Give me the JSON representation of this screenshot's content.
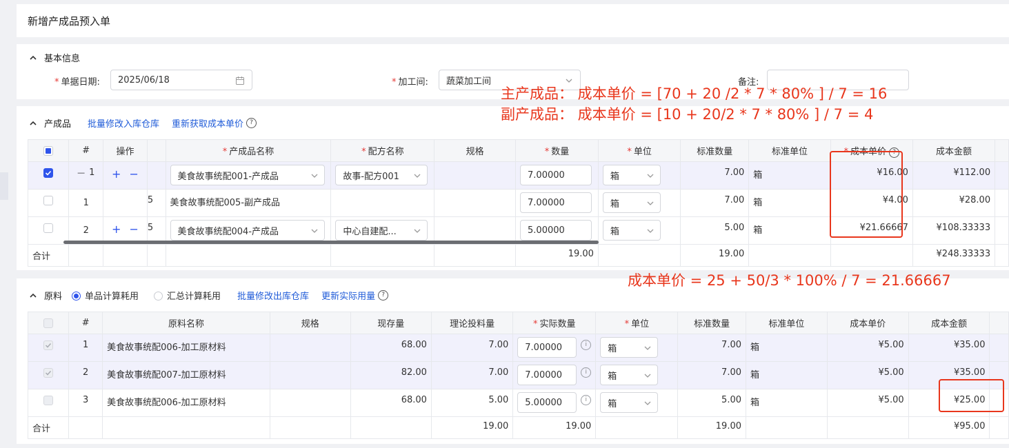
{
  "page": {
    "title": "新增产成品预入单"
  },
  "basic": {
    "section_title": "基本信息",
    "date_label": "单据日期:",
    "date_value": "2025/06/18",
    "workshop_label": "加工间:",
    "workshop_value": "蔬菜加工间",
    "remark_label": "备注:"
  },
  "products": {
    "section_title": "产成品",
    "link_batch": "批量修改入库仓库",
    "link_refetch": "重新获取成本单价",
    "headers": {
      "index": "#",
      "op": "操作",
      "name": "产成品名称",
      "recipe": "配方名称",
      "spec": "规格",
      "qty": "数量",
      "unit": "单位",
      "std_qty": "标准数量",
      "std_unit": "标准单位",
      "cost_price": "成本单价",
      "cost_amount": "成本金额"
    },
    "rows": [
      {
        "index": "1",
        "frag": "",
        "name": "美食故事统配001-产成品",
        "recipe": "故事-配方001",
        "qty": "7.00000",
        "unit": "箱",
        "std_qty": "7.00",
        "std_unit": "箱",
        "cost_price": "¥16.00",
        "cost_amount": "¥112.00"
      },
      {
        "index": "1",
        "frag": "5",
        "name": "美食故事统配005-副产成品",
        "recipe": "",
        "qty": "7.00000",
        "unit": "箱",
        "std_qty": "7.00",
        "std_unit": "箱",
        "cost_price": "¥4.00",
        "cost_amount": "¥28.00"
      },
      {
        "index": "2",
        "frag": "5",
        "name": "美食故事统配004-产成品",
        "recipe": "中心自建配...",
        "qty": "5.00000",
        "unit": "箱",
        "std_qty": "5.00",
        "std_unit": "箱",
        "cost_price": "¥21.66667",
        "cost_amount": "¥108.33333"
      }
    ],
    "summary": {
      "label": "合计",
      "qty": "19.00",
      "std_qty": "19.00",
      "cost_amount": "¥248.33333"
    },
    "op_plus": "+",
    "op_minus": "−"
  },
  "materials": {
    "section_title": "原料",
    "radio_single": "单品计算耗用",
    "radio_total": "汇总计算耗用",
    "link_batch": "批量修改出库仓库",
    "link_update": "更新实际用量",
    "headers": {
      "index": "#",
      "name": "原料名称",
      "spec": "规格",
      "stock": "现存量",
      "theory": "理论投料量",
      "actual": "实际数量",
      "unit": "单位",
      "std_qty": "标准数量",
      "std_unit": "标准单位",
      "cost_price": "成本单价",
      "cost_amount": "成本金额"
    },
    "rows": [
      {
        "index": "1",
        "name": "美食故事统配006-加工原材料",
        "stock": "68.00",
        "theory": "7.00",
        "actual": "7.00000",
        "unit": "箱",
        "std_qty": "7.00",
        "std_unit": "箱",
        "cost_price": "¥5.00",
        "cost_amount": "¥35.00"
      },
      {
        "index": "2",
        "name": "美食故事统配007-加工原材料",
        "stock": "82.00",
        "theory": "7.00",
        "actual": "7.00000",
        "unit": "箱",
        "std_qty": "7.00",
        "std_unit": "箱",
        "cost_price": "¥5.00",
        "cost_amount": "¥35.00"
      },
      {
        "index": "3",
        "name": "美食故事统配006-加工原材料",
        "stock": "68.00",
        "theory": "5.00",
        "actual": "5.00000",
        "unit": "箱",
        "std_qty": "5.00",
        "std_unit": "箱",
        "cost_price": "¥5.00",
        "cost_amount": "¥25.00"
      }
    ],
    "summary": {
      "label": "合计",
      "theory": "19.00",
      "actual": "19.00",
      "std_qty": "19.00",
      "cost_amount": "¥95.00"
    }
  },
  "annotations": {
    "main": "主产成品：  成本单价 = [70  + 20 /2 * 7  * 80%  ] / 7 = 16",
    "by": "副产成品：  成本单价 = [10 +  20/2 * 7  * 80%  ] / 7  = 4",
    "mat": "成本单价 = 25 + 50/3 * 100%  / 7  = 21.66667",
    "color": "#e8361c"
  },
  "colors": {
    "accent": "#2f54eb",
    "link": "#1f5bd8",
    "required": "#e53935",
    "selected_row": "#f1f1fc"
  }
}
